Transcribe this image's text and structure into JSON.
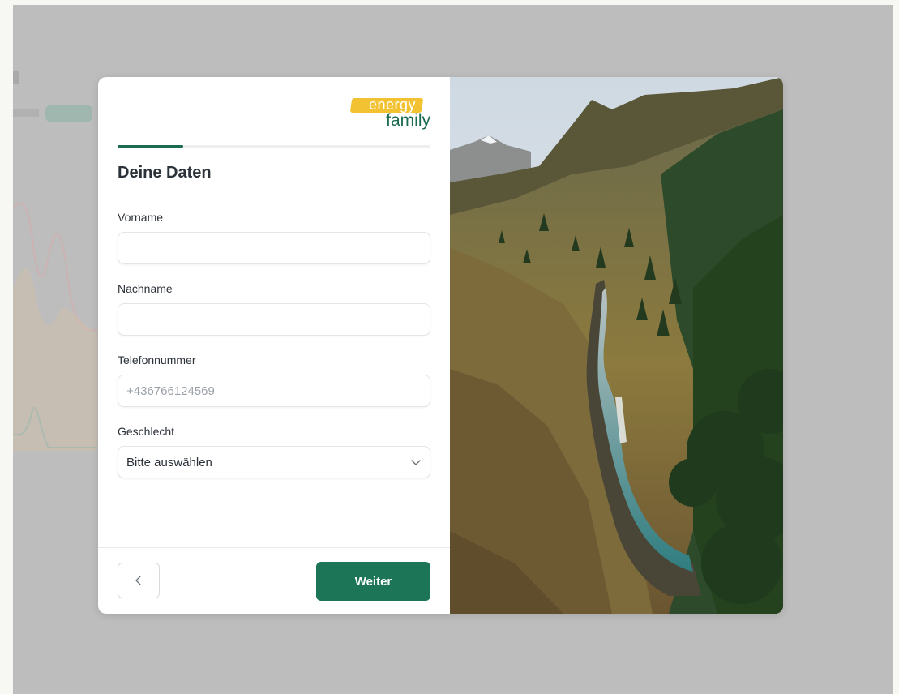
{
  "logo": {
    "top_text": "energy",
    "bottom_text": "family"
  },
  "progress": {
    "fraction": 0.21
  },
  "form": {
    "title": "Deine Daten",
    "first_name": {
      "label": "Vorname",
      "value": "",
      "placeholder": ""
    },
    "last_name": {
      "label": "Nachname",
      "value": "",
      "placeholder": ""
    },
    "phone": {
      "label": "Telefonnummer",
      "value": "",
      "placeholder": "+436766124569"
    },
    "gender": {
      "label": "Geschlecht",
      "selected": "Bitte auswählen"
    }
  },
  "footer": {
    "back_icon": "chevron-left-icon",
    "next_label": "Weiter"
  },
  "colors": {
    "brand_green": "#1b7556",
    "brand_yellow": "#f2c232",
    "overlay": "#bdbdbd"
  }
}
